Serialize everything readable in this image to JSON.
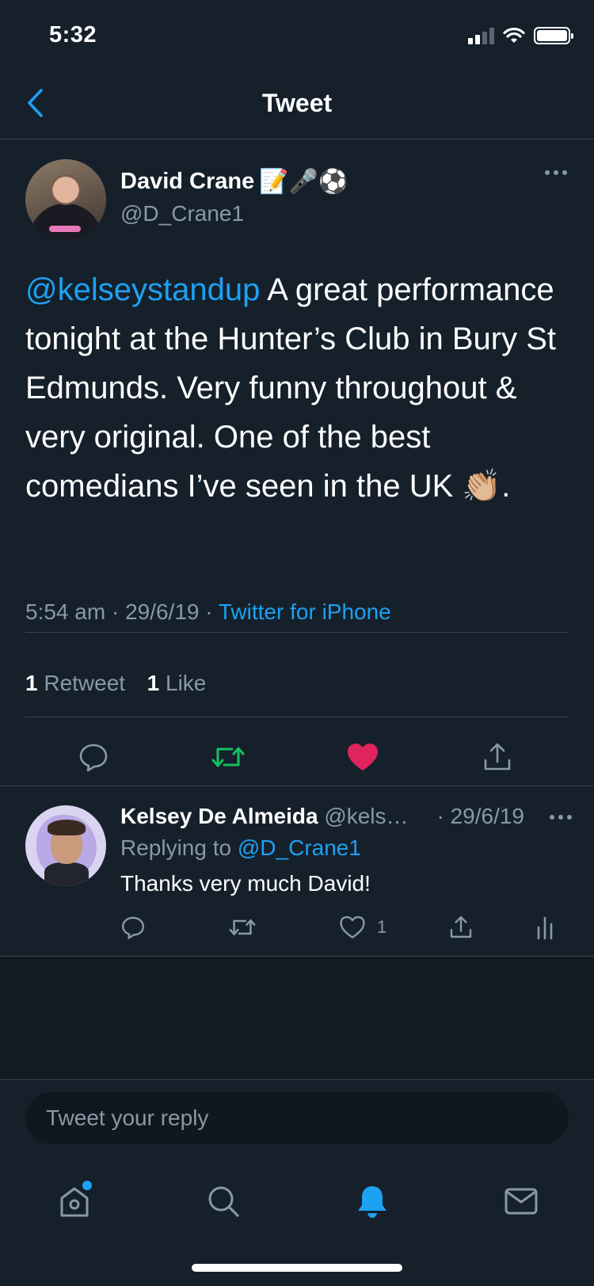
{
  "status_bar": {
    "time": "5:32"
  },
  "header": {
    "title": "Tweet"
  },
  "tweet": {
    "author_name": "David Crane",
    "author_emojis": "📝🎤⚽",
    "author_handle": "@D_Crane1",
    "mention": "@kelseystandup",
    "body": " A great performance tonight at the Hunter’s Club in Bury St Edmunds. Very funny throughout & very original. One of the best comedians I’ve seen in the UK 👏🏼.",
    "time": "5:54 am",
    "date": "29/6/19",
    "source": "Twitter for iPhone",
    "retweet_count": "1",
    "retweet_label": "Retweet",
    "like_count": "1",
    "like_label": "Like",
    "liked": true,
    "colors": {
      "mention": "#1da1f2",
      "retweet": "#17bf63",
      "like": "#e0245e"
    }
  },
  "reply": {
    "author_name": "Kelsey De Almeida",
    "author_handle": "@kels…",
    "date": "· 29/6/19",
    "replying_to_label": "Replying to",
    "replying_to_handle": "@D_Crane1",
    "body": "Thanks very much David!",
    "like_count": "1"
  },
  "composer": {
    "placeholder": "Tweet your reply"
  },
  "tab_bar": {
    "items": [
      "home-icon",
      "search-icon",
      "notifications-icon",
      "messages-icon"
    ],
    "active": "notifications-icon"
  }
}
